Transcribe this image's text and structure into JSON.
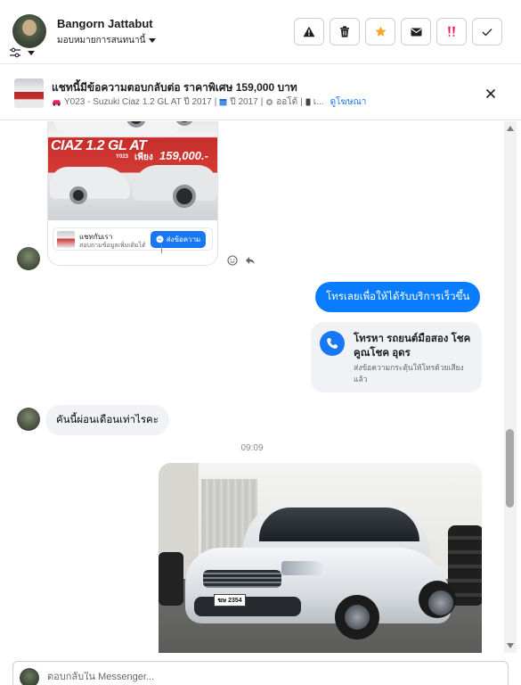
{
  "header": {
    "user_name": "Bangorn Jattabut",
    "assign_label": "มอบหมายการสนทนานี้",
    "actions": [
      {
        "name": "report-spam-button",
        "icon": "warning-triangle-icon",
        "color": "#1c1e21"
      },
      {
        "name": "delete-button",
        "icon": "trash-icon",
        "color": "#1c1e21"
      },
      {
        "name": "star-button",
        "icon": "star-icon",
        "color": "#f5a623"
      },
      {
        "name": "mark-unread-button",
        "icon": "envelope-icon",
        "color": "#1c1e21"
      },
      {
        "name": "follow-up-button",
        "icon": "double-exclamation-icon",
        "color": "#e0245e"
      },
      {
        "name": "mark-done-button",
        "icon": "checkmark-icon",
        "color": "#1c1e21"
      }
    ]
  },
  "ad_banner": {
    "title": "แชทนี้มีข้อความตอบกลับต่อ ราคาพิเศษ 159,000 บาท",
    "vehicle": "Y023 - Suzuki Ciaz 1.2 GL AT ปี 2017",
    "year": "ปี 2017",
    "transmission": "ออโต้",
    "more": "เ...",
    "view_ad_link": "ดูโฆษณา"
  },
  "chat": {
    "ad_card": {
      "model": "CIAZ 1.2 GL AT",
      "code": "Y023",
      "price_word": "เพียง",
      "price": "159,000.-",
      "cta_title": "แชทกับเรา",
      "cta_subtitle": "สอบถามข้อมูลเพิ่มเติมได้ทันที",
      "cta_button": "ส่งข้อความ"
    },
    "outgoing_message_1": "โทรเลยเพื่อให้ได้รับบริการเร็วขึ้น",
    "call_card": {
      "title": "โทรหา รถยนต์มือสอง โชคคูณโชค อุดร",
      "subtitle": "ส่งข้อความกระตุ้นให้โทรด้วยเสียงแล้ว"
    },
    "incoming_message_1": "คันนี้ผ่อนเดือนเท่าไรคะ",
    "timestamp": "09:09",
    "photo": {
      "plate": "ฆษ 2354"
    }
  },
  "composer": {
    "placeholder": "ตอบกลับใน Messenger..."
  },
  "colors": {
    "brand_blue": "#0a7cff",
    "link_blue": "#1877f2",
    "incoming_bubble": "#f0f2f5",
    "star_orange": "#f5a623",
    "followup_red": "#e0245e"
  }
}
